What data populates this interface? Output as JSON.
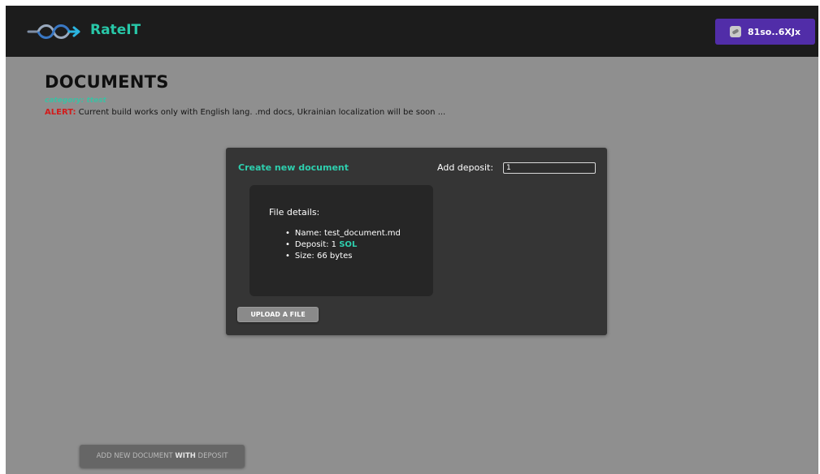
{
  "header": {
    "brand": "RateIT",
    "wallet_label": "81so..6XJx",
    "logo_icon": "infinity-arrow-logo-icon",
    "wallet_icon": "wallet-icon"
  },
  "page": {
    "title": "DOCUMENTS",
    "category_text": "category: ttest",
    "alert_label": "ALERT:",
    "alert_text": " Current build works only with English lang. .md docs, Ukrainian localization will be soon ..."
  },
  "card": {
    "title": "Create new document",
    "deposit_label": "Add deposit:",
    "deposit_value": "1",
    "details_heading": "File details:",
    "name_item": "Name: test_document.md",
    "deposit_item_prefix": "Deposit: 1 ",
    "deposit_item_unit": "SOL",
    "size_item": "Size: 66 bytes",
    "upload_label": "UPLOAD A FILE"
  },
  "footer": {
    "add_prefix": "ADD NEW DOCUMENT ",
    "add_bold": "WITH",
    "add_suffix": " DEPOSIT"
  },
  "colors": {
    "accent": "#28c7a8",
    "wallet": "#512da8",
    "alert": "#d21b1b",
    "background": "#8f8f8f",
    "topbar": "#1c1c1c"
  }
}
